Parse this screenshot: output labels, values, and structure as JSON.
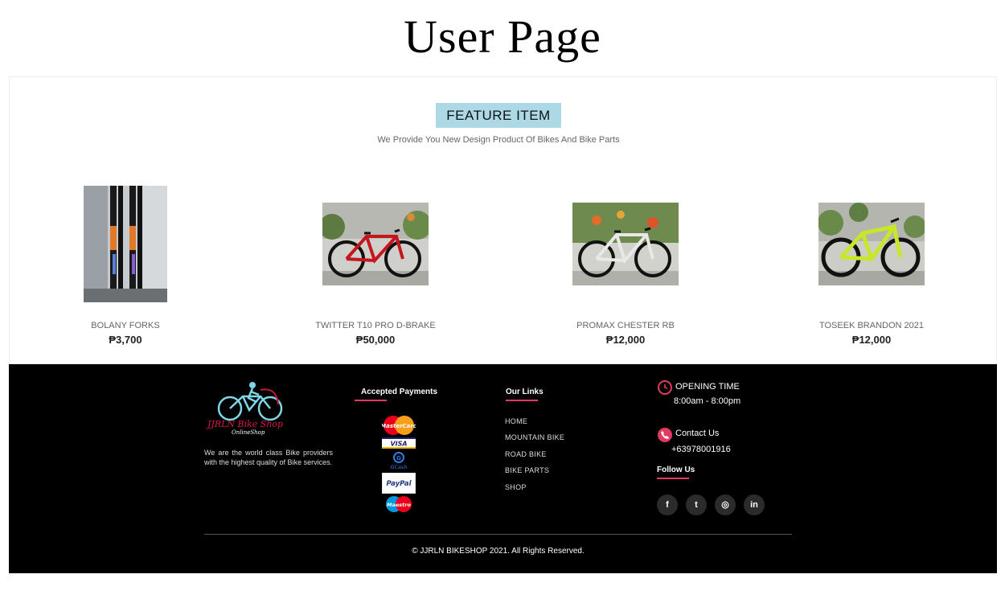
{
  "page": {
    "heading": "User Page"
  },
  "feature": {
    "badge": "FEATURE ITEM",
    "subtitle": "We Provide You New Design Product Of Bikes And Bike Parts"
  },
  "products": [
    {
      "name": "BOLANY FORKS",
      "price": "₱3,700"
    },
    {
      "name": "TWITTER T10 PRO D-BRAKE",
      "price": "₱50,000"
    },
    {
      "name": "PROMAX CHESTER RB",
      "price": "₱12,000"
    },
    {
      "name": "TOSEEK BRANDON 2021",
      "price": "₱12,000"
    }
  ],
  "footer": {
    "logo": {
      "name": "JJRLN Bike Shop",
      "tagline": "OnlineShop"
    },
    "about": "We are the world class Bike providers with the highest quality of Bike services.",
    "payments": {
      "title": "Accepted Payments",
      "methods": [
        "MasterCard",
        "VISA",
        "GCash",
        "PayPal",
        "Maestro"
      ]
    },
    "links": {
      "title": "Our Links",
      "items": [
        "HOME",
        "MOUNTAIN BIKE",
        "ROAD BIKE",
        "BIKE PARTS",
        "SHOP"
      ]
    },
    "contact": {
      "opening_title": "OPENING TIME",
      "opening_value": "8:00am - 8:00pm",
      "contact_title": "Contact Us",
      "contact_value": "+63978001916",
      "follow_title": "Follow Us",
      "social": [
        {
          "icon": "facebook-icon",
          "glyph": "f"
        },
        {
          "icon": "twitter-icon",
          "glyph": "t"
        },
        {
          "icon": "instagram-icon",
          "glyph": "◎"
        },
        {
          "icon": "linkedin-icon",
          "glyph": "in"
        }
      ]
    },
    "copyright": "© JJRLN BIKESHOP 2021. All Rights Reserved."
  },
  "colors": {
    "badge_bg": "#add8e6",
    "accent": "#e23a5f",
    "footer_bg": "#000000"
  }
}
